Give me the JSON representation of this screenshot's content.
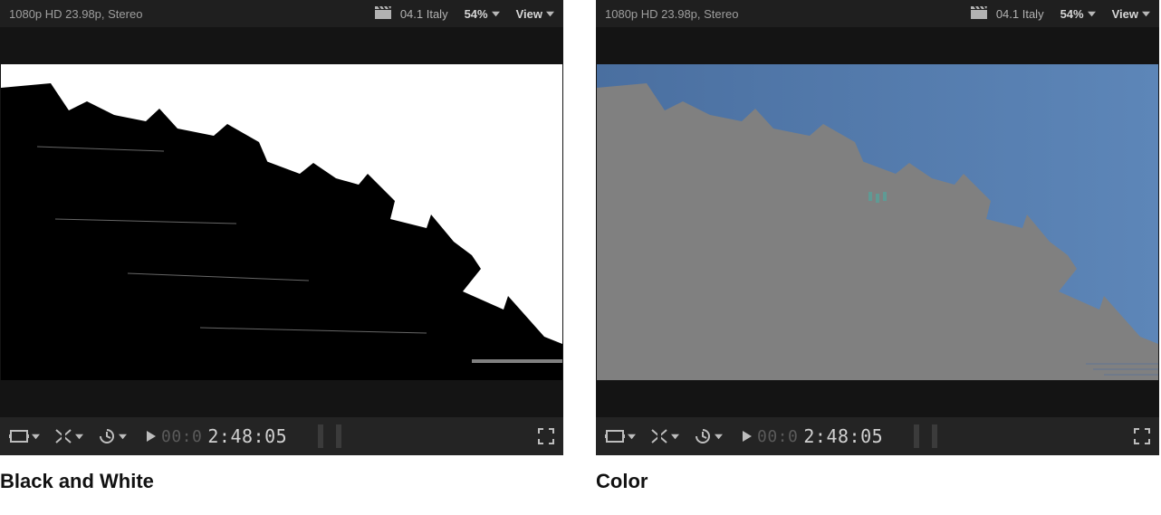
{
  "panels": {
    "left": {
      "format_label": "1080p HD 23.98p, Stereo",
      "clip_name": "04.1 Italy",
      "zoom_label": "54%",
      "view_label": "View",
      "timecode_ghost": "00:0",
      "timecode": "2:48:05",
      "caption": "Black and White"
    },
    "right": {
      "format_label": "1080p HD 23.98p, Stereo",
      "clip_name": "04.1 Italy",
      "zoom_label": "54%",
      "view_label": "View",
      "timecode_ghost": "00:0",
      "timecode": "2:48:05",
      "caption": "Color"
    }
  },
  "icons": {
    "clapper": "clapper-icon",
    "chevron_down": "chevron-down-icon",
    "frame_tool": "frame-tool-icon",
    "trim_tool": "trim-tool-icon",
    "retime_tool": "retime-tool-icon",
    "play": "play-icon",
    "fullscreen": "fullscreen-icon"
  }
}
